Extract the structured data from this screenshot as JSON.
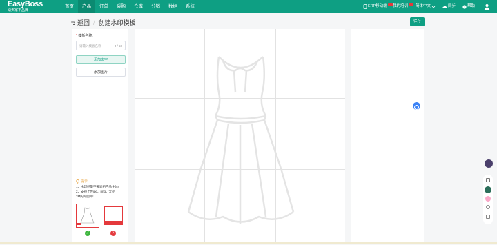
{
  "topbar": {
    "logo_name": "EasyBoss",
    "logo_slogan": "助卖家下品牌",
    "nav": [
      "首页",
      "产品",
      "订单",
      "采购",
      "仓库",
      "分销",
      "数据",
      "系统"
    ],
    "erp_mobile": "ERP移动端",
    "training": "我的培训",
    "language": "简体中文",
    "sync": "同步",
    "help": "帮助"
  },
  "header": {
    "back": "返回",
    "title": "创建水印模板",
    "save": "保存"
  },
  "form": {
    "required_mark": "*",
    "name_label": "模板名称:",
    "name_placeholder": "请输入模板名称",
    "name_count": "0 / 50",
    "add_text": "添加文字",
    "add_image": "添加图片"
  },
  "tips": {
    "title": "提示",
    "line1": "1、水印尽量不要遮挡产品主体!",
    "line2": "2、支持上传jpg、png，大小",
    "line3": "2M内的图片!"
  },
  "colors": {
    "brand": "#0e9f83",
    "ok": "#3db53d",
    "bad": "#e4393c"
  }
}
